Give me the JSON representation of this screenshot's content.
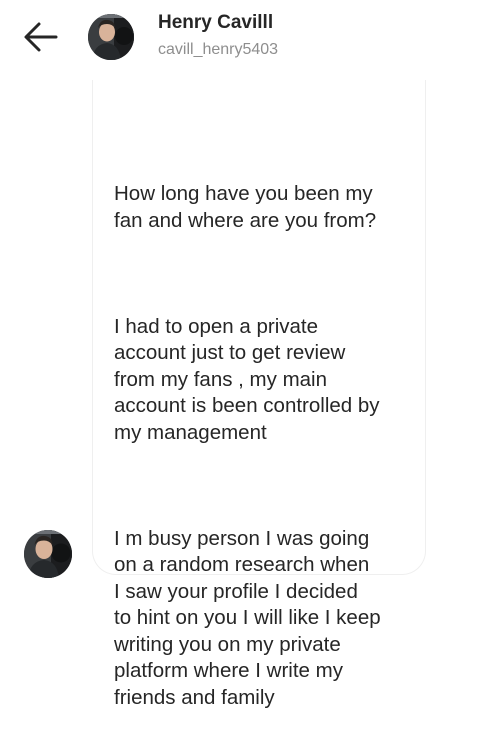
{
  "header": {
    "back_icon": "arrow-left-icon",
    "avatar_icon": "profile-photo",
    "name": "Henry Cavilll",
    "username": "cavill_henry5403"
  },
  "conversation": {
    "message": {
      "paragraphs": [
        "How long have you been my\nfan and where are you from?",
        "I had to open a private\naccount just to get review\nfrom my fans , my main\naccount is been controlled by\nmy management",
        "I m busy person I was going\non a random research when\nI saw your profile I decided\nto hint on you I will like I keep\nwriting you on my private\nplatform where I write my\nfriends and family"
      ]
    },
    "sender_avatar_icon": "profile-photo"
  },
  "colors": {
    "name": "#262626",
    "username": "#8e8e8e",
    "bubble_border": "#efefef"
  }
}
